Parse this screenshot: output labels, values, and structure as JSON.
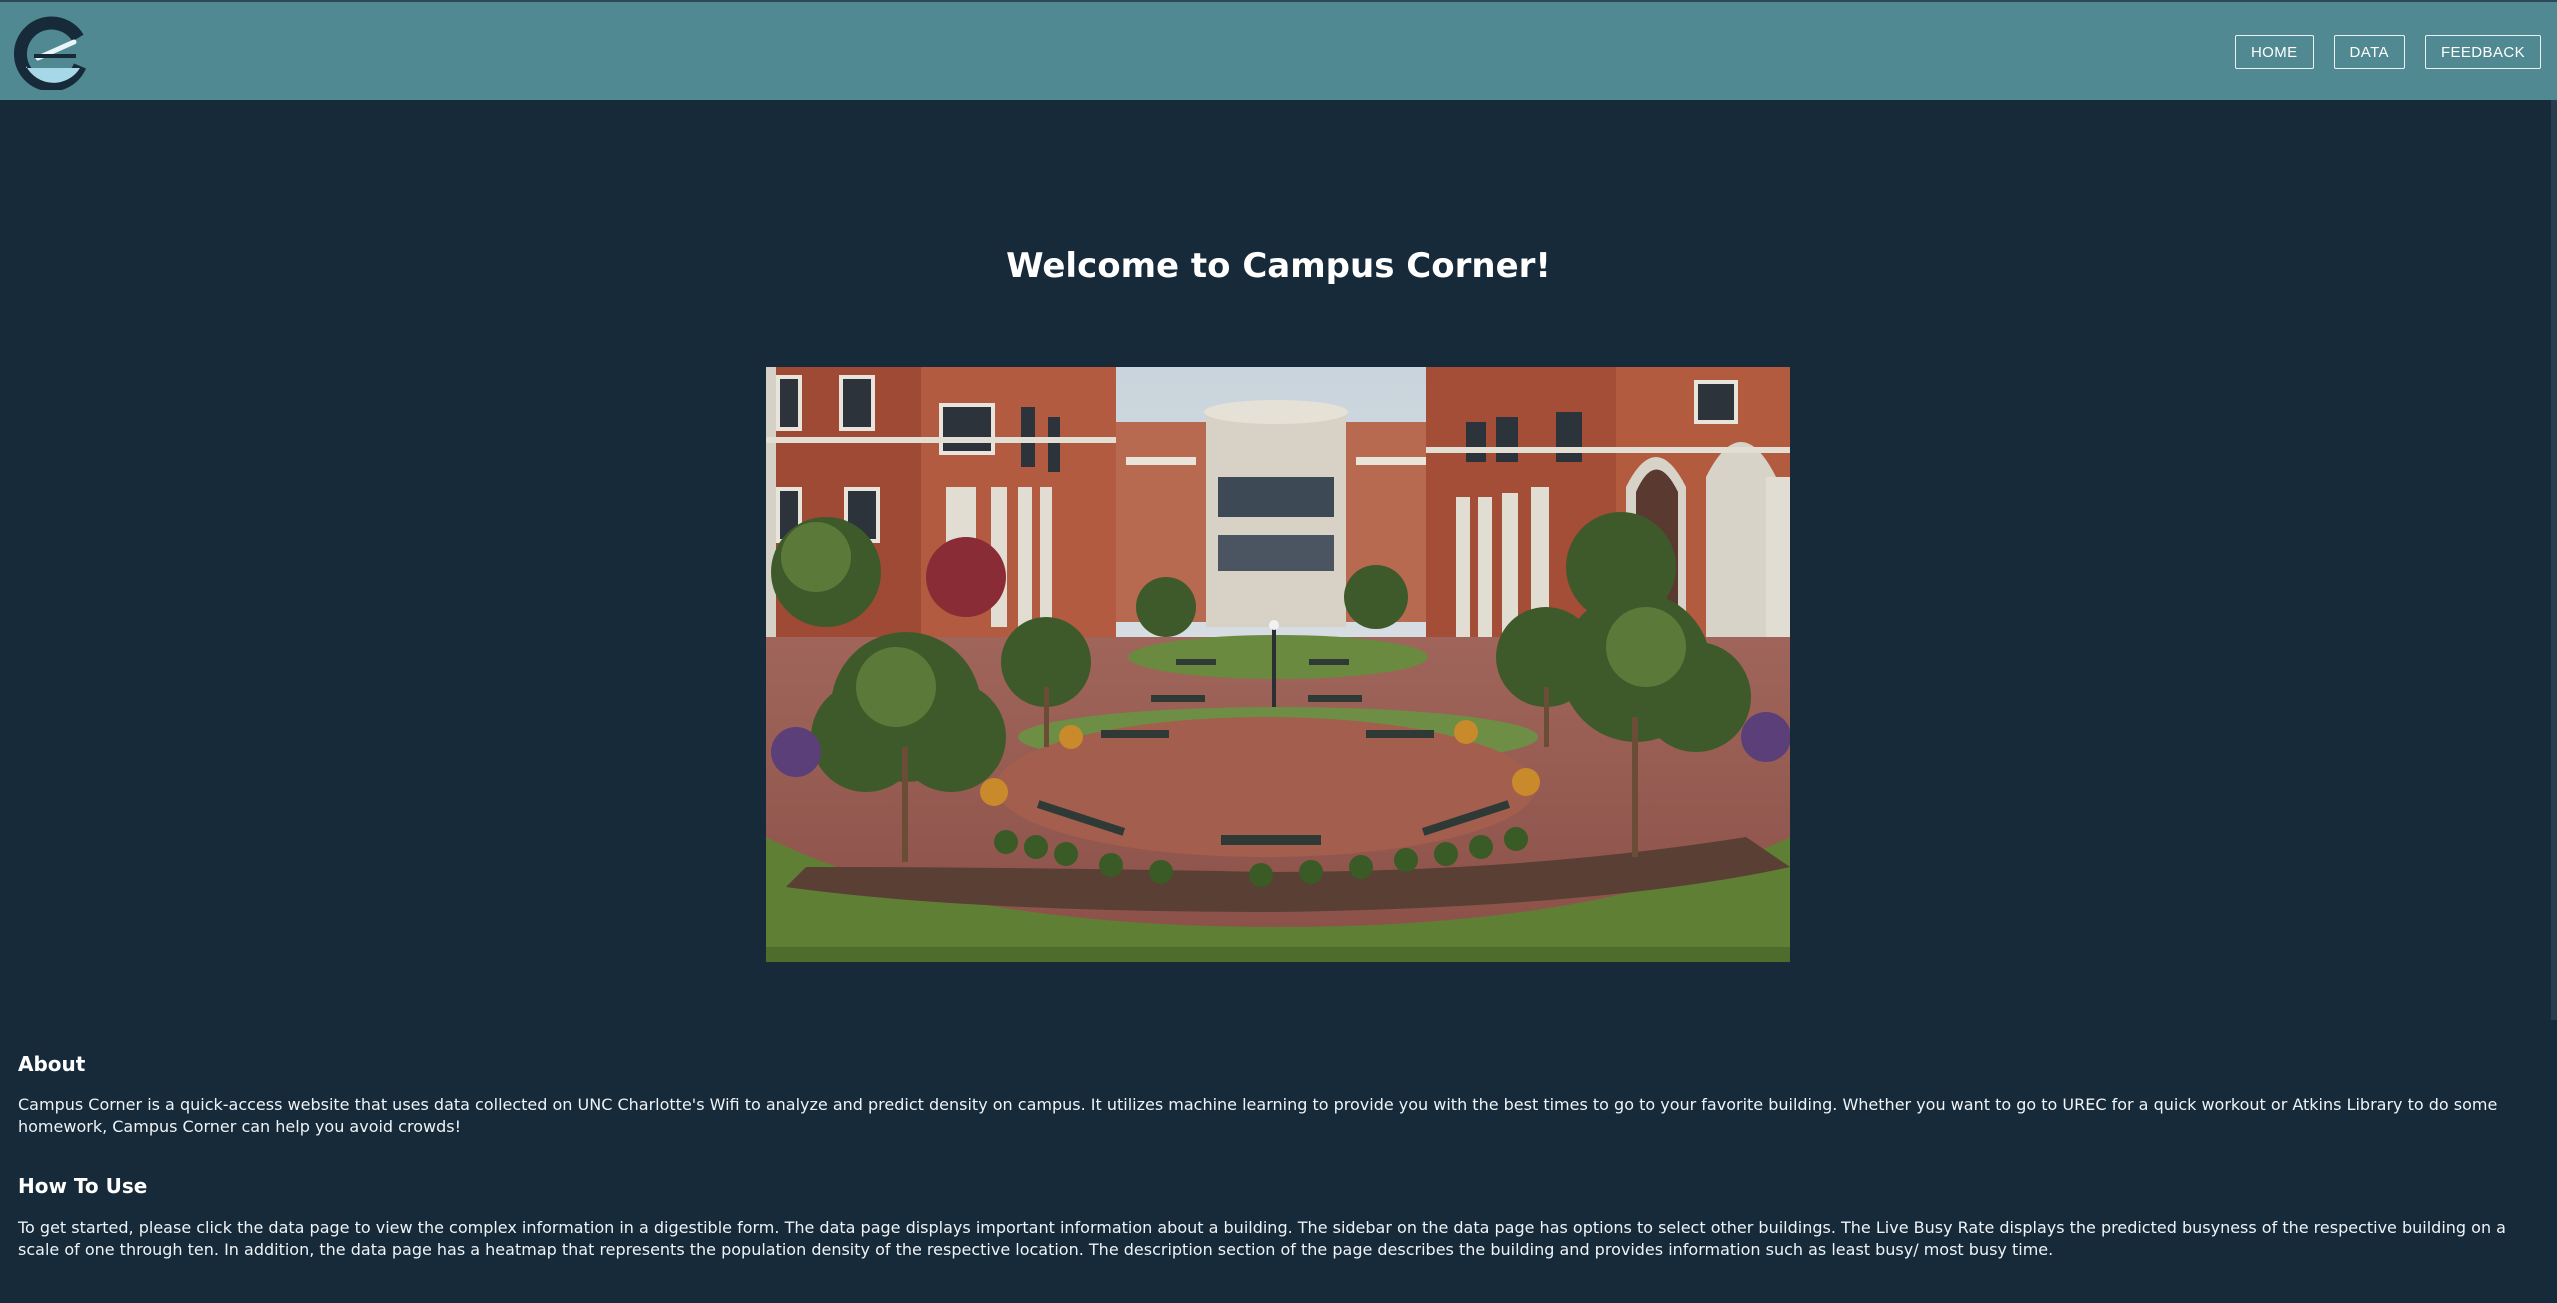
{
  "nav": {
    "home_label": "HOME",
    "data_label": "DATA",
    "feedback_label": "FEEDBACK"
  },
  "hero": {
    "title": "Welcome to Campus Corner!"
  },
  "about": {
    "heading": "About",
    "body": "Campus Corner is a quick-access website that uses data collected on UNC Charlotte's Wifi to analyze and predict density on campus. It utilizes machine learning to provide you with the best times to go to your favorite building. Whether you want to go to UREC for a quick workout or Atkins Library to do some homework, Campus Corner can help you avoid crowds!"
  },
  "how_to_use": {
    "heading": "How To Use",
    "body": "To get started, please click the data page to view the complex information in a digestible form. The data page displays important information about a building. The sidebar on the data page has options to select other buildings. The Live Busy Rate displays the predicted busyness of the respective building on a scale of one through ten. In addition, the data page has a heatmap that represents the population density of the respective location. The description section of the page describes the building and provides information such as least busy/ most busy time."
  },
  "colors": {
    "header": "#508991",
    "background": "#172a3a",
    "logo_dark": "#172a3a",
    "logo_light": "#a7d8e8"
  },
  "icons": {
    "logo": "campus-corner-c-logo"
  }
}
